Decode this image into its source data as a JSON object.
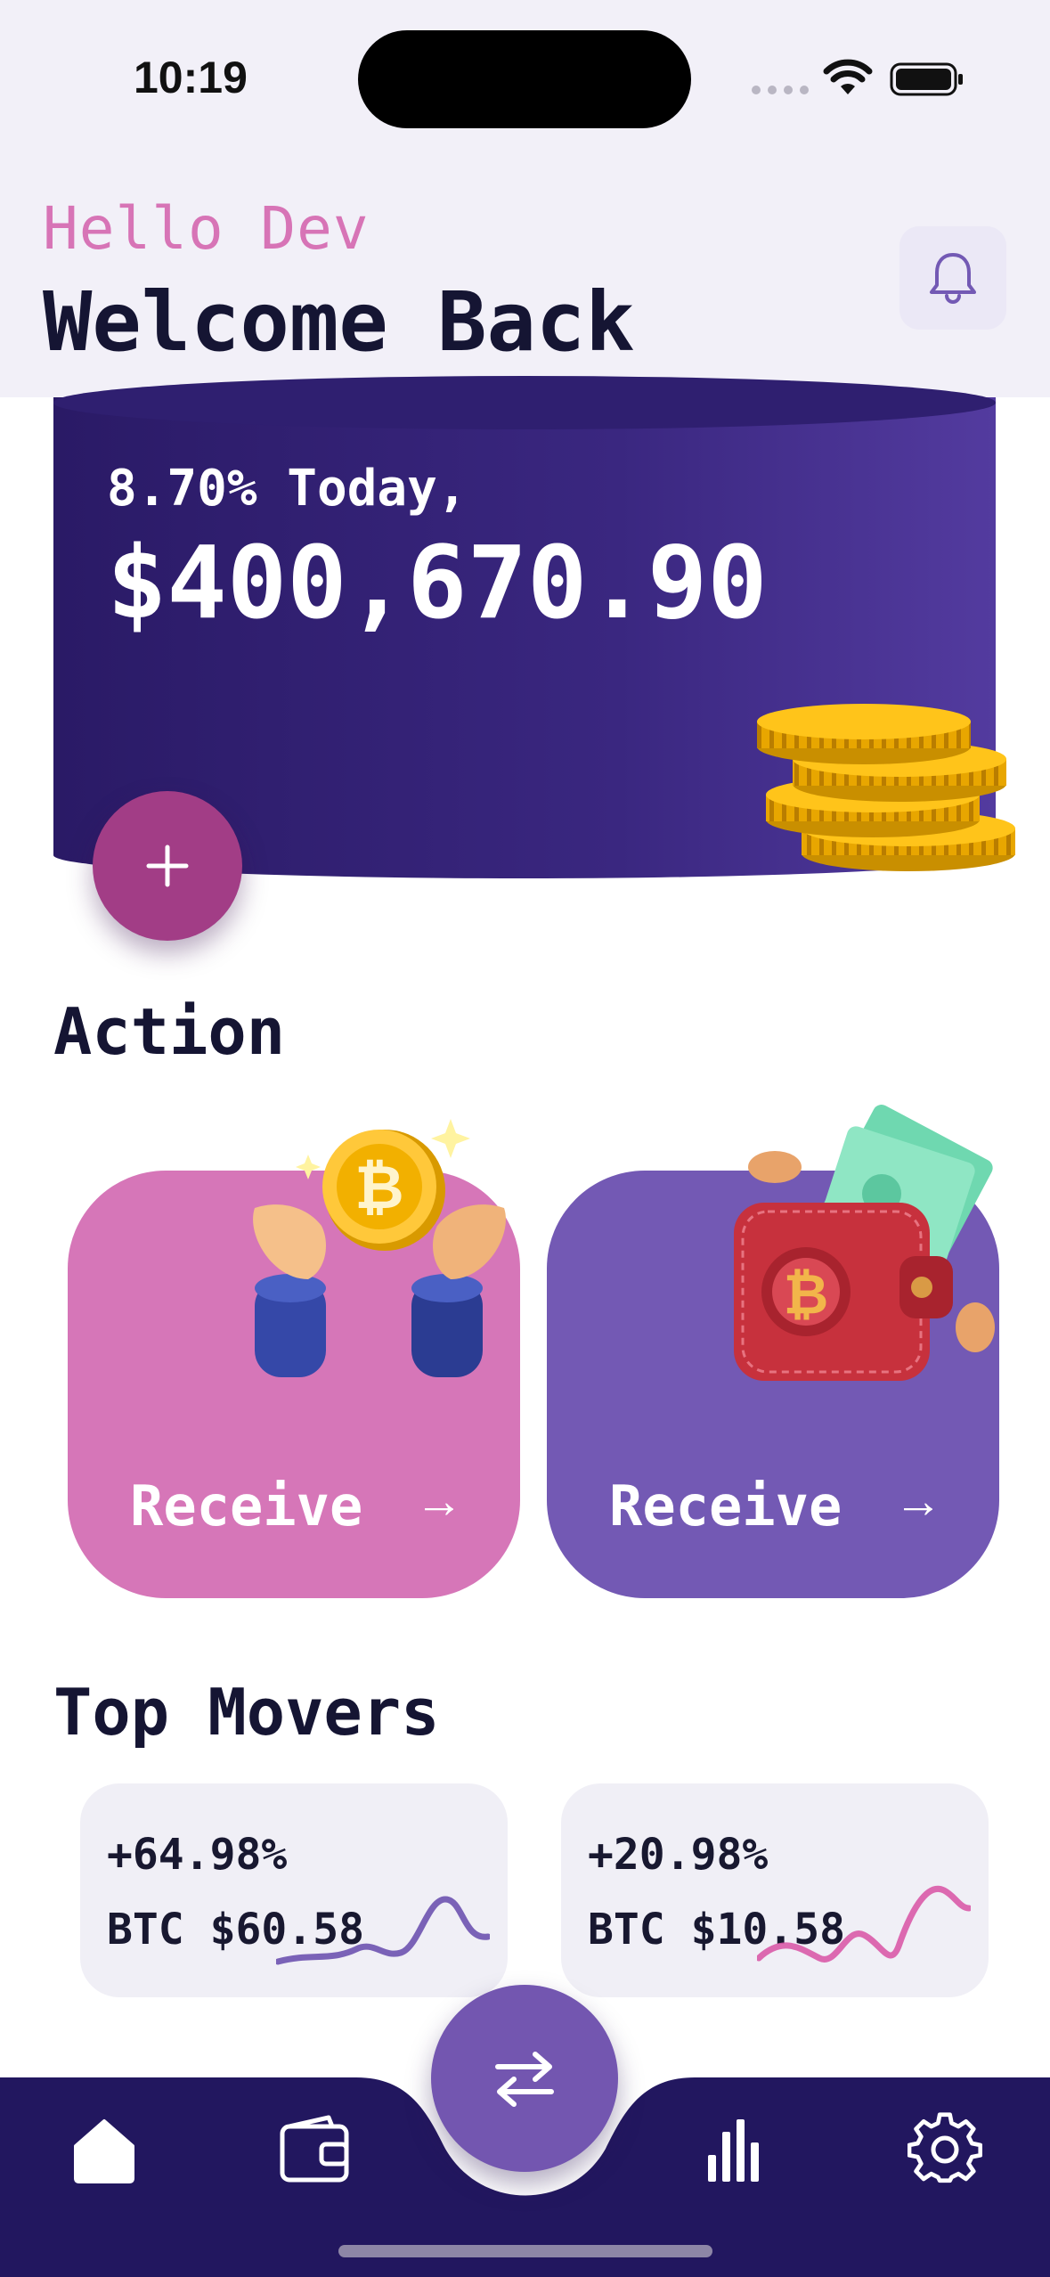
{
  "status_bar": {
    "time": "10:19"
  },
  "header": {
    "greeting": "Hello Dev",
    "title": "Welcome Back"
  },
  "balance": {
    "change_label": "8.70% Today,",
    "amount": "$400,670.90"
  },
  "sections": {
    "action_title": "Action",
    "movers_title": "Top Movers"
  },
  "actions": [
    {
      "label": "Receive",
      "arrow": "→"
    },
    {
      "label": "Receive",
      "arrow": "→"
    }
  ],
  "movers": [
    {
      "change": "+64.98%",
      "price": "BTC $60.58"
    },
    {
      "change": "+20.98%",
      "price": "BTC $10.58"
    }
  ],
  "colors": {
    "accent_pink": "#d676b8",
    "accent_purple": "#7359b4",
    "card_dark": "#2a1a66",
    "nav_bg": "#22175f",
    "text_dark": "#151533"
  },
  "icons": {
    "header": "bell-icon",
    "card_fab": "plus-icon",
    "center_fab": "swap-arrows-icon",
    "nav": [
      "home-icon",
      "wallet-icon",
      "bar-chart-icon",
      "settings-gear-icon"
    ]
  }
}
